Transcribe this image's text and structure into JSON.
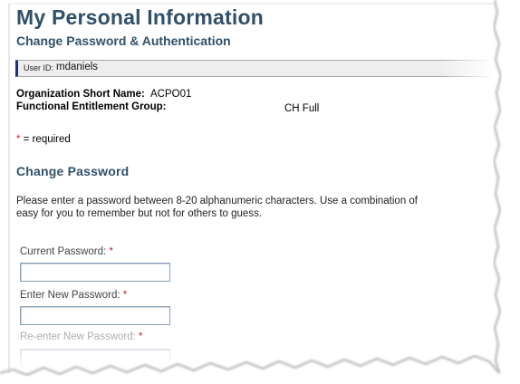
{
  "header": {
    "title": "My Personal Information",
    "subtitle": "Change Password & Authentication"
  },
  "user_bar": {
    "label": "User ID:",
    "value": "mdaniels"
  },
  "organization": {
    "short_name_label": "Organization Short Name:",
    "short_name_value": "ACPO01",
    "entitlement_label": "Functional Entitlement Group:",
    "entitlement_value": "CH Full"
  },
  "required_note": {
    "star": "*",
    "text": " = required"
  },
  "change_password": {
    "heading": "Change Password",
    "description_line1": "Please enter a password between 8-20 alphanumeric characters. Use a combination of",
    "description_line2": "easy for you to remember but not for others to guess.",
    "fields": [
      {
        "label": "Current Password:",
        "required": "*",
        "value": ""
      },
      {
        "label": "Enter New Password:",
        "required": "*",
        "value": ""
      },
      {
        "label": "Re-enter New Password:",
        "required": "*",
        "value": ""
      }
    ]
  },
  "colors": {
    "heading": "#30506a",
    "required_star": "#d0202c",
    "user_bar_accent": "#1e2f7a"
  }
}
